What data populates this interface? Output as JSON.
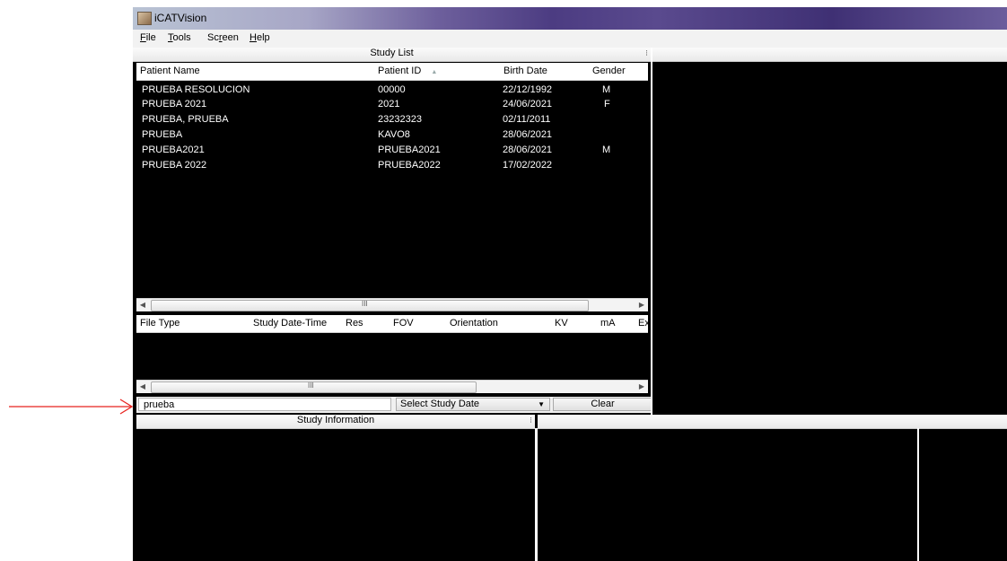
{
  "window": {
    "title": "iCATVision"
  },
  "menu": [
    {
      "label_pre": "",
      "label_ul": "F",
      "label_post": "ile"
    },
    {
      "label_pre": "",
      "label_ul": "T",
      "label_post": "ools"
    },
    {
      "label_pre": "Sc",
      "label_ul": "r",
      "label_post": "een"
    },
    {
      "label_pre": "",
      "label_ul": "H",
      "label_post": "elp"
    }
  ],
  "study_list": {
    "title": "Study List",
    "columns": [
      "Patient Name",
      "Patient ID",
      "Birth Date",
      "Gender"
    ],
    "sort_indicator": "▲",
    "rows": [
      {
        "name": "PRUEBA RESOLUCION",
        "id": "00000",
        "birth": "22/12/1992",
        "gender": "M"
      },
      {
        "name": "PRUEBA 2021",
        "id": "2021",
        "birth": "24/06/2021",
        "gender": "F"
      },
      {
        "name": "PRUEBA, PRUEBA",
        "id": "23232323",
        "birth": "02/11/2011",
        "gender": ""
      },
      {
        "name": "PRUEBA",
        "id": "KAVO8",
        "birth": "28/06/2021",
        "gender": ""
      },
      {
        "name": "PRUEBA2021",
        "id": "PRUEBA2021",
        "birth": "28/06/2021",
        "gender": "M"
      },
      {
        "name": "PRUEBA 2022",
        "id": "PRUEBA2022",
        "birth": "17/02/2022",
        "gender": ""
      }
    ]
  },
  "scans": {
    "columns": [
      "File Type",
      "Study Date-Time",
      "Res",
      "FOV",
      "Orientation",
      "KV",
      "mA",
      "Ex"
    ]
  },
  "scroll_grip": "III",
  "search": {
    "value": "prueba",
    "select_label": "Select Study Date",
    "clear_label": "Clear"
  },
  "study_info": {
    "title": "Study Information"
  },
  "colors": {
    "arrow": "#e8231f",
    "background": "#000000"
  }
}
